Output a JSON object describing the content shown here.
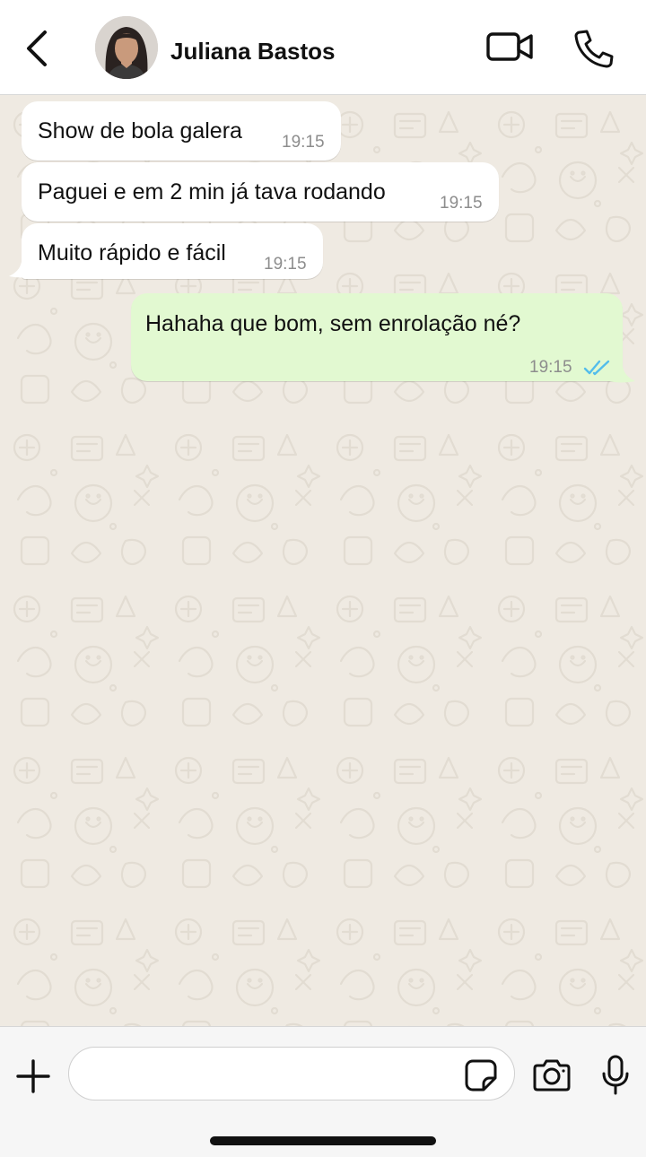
{
  "header": {
    "back_icon": "chevron-left-icon",
    "contact_name": "Juliana Bastos",
    "video_icon": "video-camera-icon",
    "call_icon": "phone-icon"
  },
  "messages": [
    {
      "direction": "incoming",
      "text": "Show de bola galera",
      "time": "19:15"
    },
    {
      "direction": "incoming",
      "text": "Paguei e em 2 min já tava rodando",
      "time": "19:15"
    },
    {
      "direction": "incoming",
      "text": "Muito rápido e fácil",
      "time": "19:15"
    },
    {
      "direction": "outgoing",
      "text": "Hahaha que bom, sem enrolação né?",
      "time": "19:15",
      "status": "read"
    }
  ],
  "composer": {
    "value": "",
    "placeholder": "",
    "plus_icon": "plus-icon",
    "sticker_icon": "sticker-icon",
    "camera_icon": "camera-icon",
    "mic_icon": "microphone-icon"
  },
  "colors": {
    "chat_background": "#efeae2",
    "incoming_bubble": "#ffffff",
    "outgoing_bubble": "#e2f9d1",
    "read_ticks": "#53bdeb",
    "timestamp": "#8d8d8d"
  }
}
